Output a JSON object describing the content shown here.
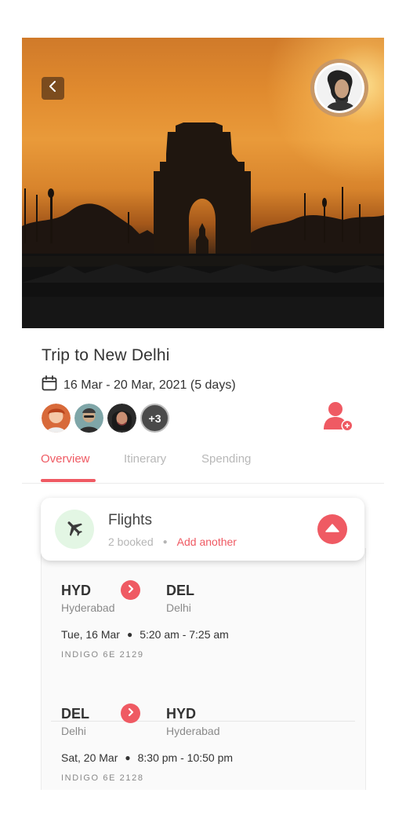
{
  "trip": {
    "title": "Trip to New Delhi",
    "dates": "16 Mar - 20 Mar, 2021 (5 days)",
    "travelers_more": "+3"
  },
  "tabs": [
    {
      "label": "Overview",
      "active": true
    },
    {
      "label": "Itinerary",
      "active": false
    },
    {
      "label": "Spending",
      "active": false
    }
  ],
  "flights_card": {
    "title": "Flights",
    "booked": "2 booked",
    "add_label": "Add another"
  },
  "flights": [
    {
      "from_code": "HYD",
      "from_city": "Hyderabad",
      "to_code": "DEL",
      "to_city": "Delhi",
      "date": "Tue, 16 Mar",
      "time": "5:20 am - 7:25 am",
      "flight_no": "INDIGO 6E 2129"
    },
    {
      "from_code": "DEL",
      "from_city": "Delhi",
      "to_code": "HYD",
      "to_city": "Hyderabad",
      "date": "Sat, 20 Mar",
      "time": "8:30 pm - 10:50 pm",
      "flight_no": "INDIGO 6E 2128"
    }
  ],
  "colors": {
    "accent": "#ef5a63",
    "muted": "#b5b5b5",
    "plane_bg": "#e3f6e4"
  },
  "icons": [
    "chevron-left-icon",
    "calendar-icon",
    "add-user-icon",
    "plane-icon",
    "chevron-up-icon",
    "chevron-right-icon"
  ]
}
